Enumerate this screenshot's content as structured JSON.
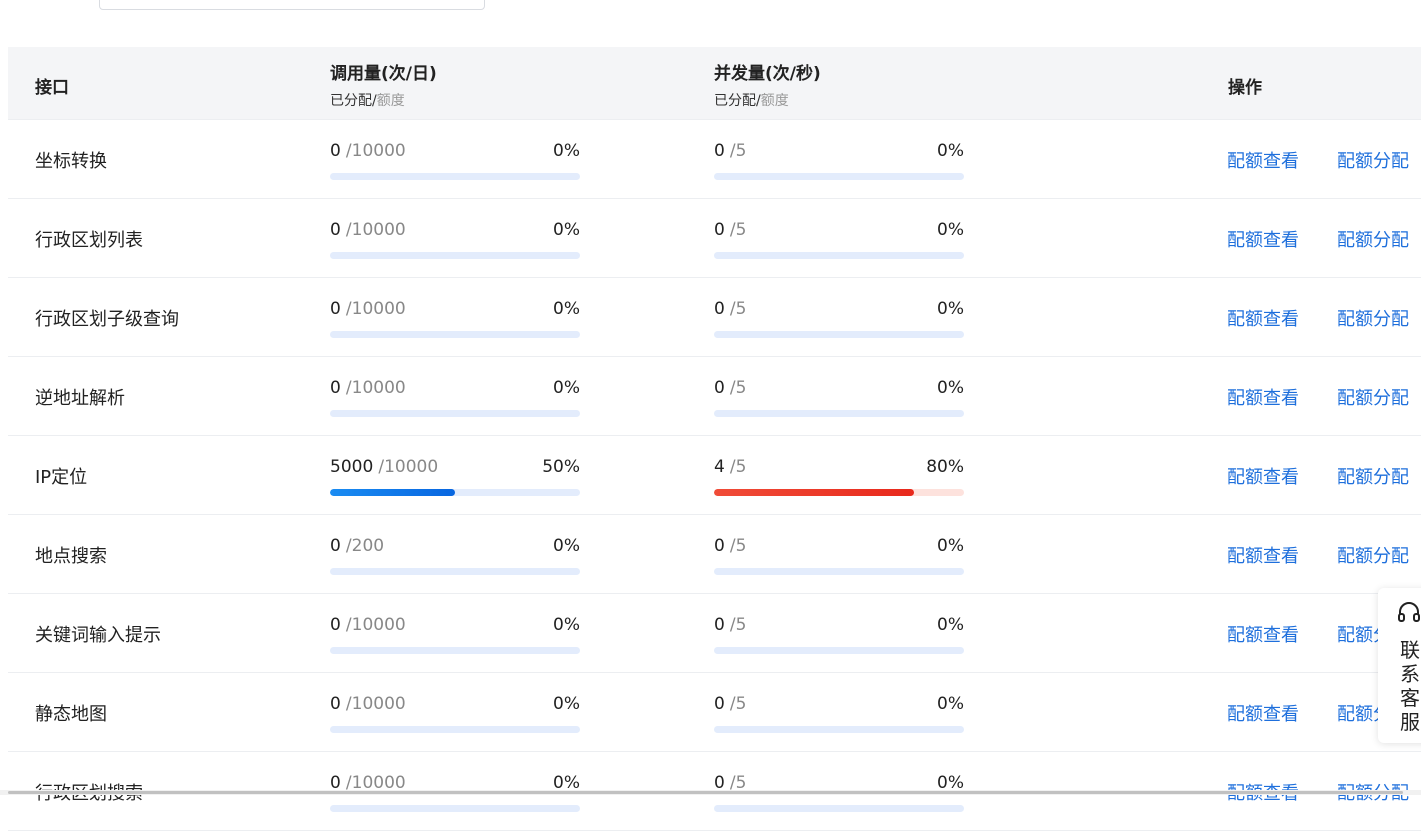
{
  "header": {
    "api": "接口",
    "calls_title": "调用量(次/日)",
    "concurrency_title": "并发量(次/秒)",
    "sub_allocated": "已分配/",
    "sub_quota": "额度",
    "ops": "操作"
  },
  "rows": [
    {
      "name": "坐标转换",
      "calls": {
        "used": "0",
        "quota": "/10000",
        "pct": "0%",
        "fraction": 0
      },
      "conc": {
        "used": "0",
        "quota": "/5",
        "pct": "0%",
        "fraction": 0
      },
      "view": "配额查看",
      "assign": "配额分配"
    },
    {
      "name": "行政区划列表",
      "calls": {
        "used": "0",
        "quota": "/10000",
        "pct": "0%",
        "fraction": 0
      },
      "conc": {
        "used": "0",
        "quota": "/5",
        "pct": "0%",
        "fraction": 0
      },
      "view": "配额查看",
      "assign": "配额分配"
    },
    {
      "name": "行政区划子级查询",
      "calls": {
        "used": "0",
        "quota": "/10000",
        "pct": "0%",
        "fraction": 0
      },
      "conc": {
        "used": "0",
        "quota": "/5",
        "pct": "0%",
        "fraction": 0
      },
      "view": "配额查看",
      "assign": "配额分配"
    },
    {
      "name": "逆地址解析",
      "calls": {
        "used": "0",
        "quota": "/10000",
        "pct": "0%",
        "fraction": 0
      },
      "conc": {
        "used": "0",
        "quota": "/5",
        "pct": "0%",
        "fraction": 0
      },
      "view": "配额查看",
      "assign": "配额分配"
    },
    {
      "name": "IP定位",
      "calls": {
        "used": "5000",
        "quota": "/10000",
        "pct": "50%",
        "fraction": 0.5
      },
      "conc": {
        "used": "4",
        "quota": "/5",
        "pct": "80%",
        "fraction": 0.8,
        "alert": true
      },
      "view": "配额查看",
      "assign": "配额分配"
    },
    {
      "name": "地点搜索",
      "calls": {
        "used": "0",
        "quota": "/200",
        "pct": "0%",
        "fraction": 0
      },
      "conc": {
        "used": "0",
        "quota": "/5",
        "pct": "0%",
        "fraction": 0
      },
      "view": "配额查看",
      "assign": "配额分配"
    },
    {
      "name": "关键词输入提示",
      "calls": {
        "used": "0",
        "quota": "/10000",
        "pct": "0%",
        "fraction": 0
      },
      "conc": {
        "used": "0",
        "quota": "/5",
        "pct": "0%",
        "fraction": 0
      },
      "view": "配额查看",
      "assign": "配额分配"
    },
    {
      "name": "静态地图",
      "calls": {
        "used": "0",
        "quota": "/10000",
        "pct": "0%",
        "fraction": 0
      },
      "conc": {
        "used": "0",
        "quota": "/5",
        "pct": "0%",
        "fraction": 0
      },
      "view": "配额查看",
      "assign": "配额分配"
    },
    {
      "name": "行政区划搜索",
      "calls": {
        "used": "0",
        "quota": "/10000",
        "pct": "0%",
        "fraction": 0
      },
      "conc": {
        "used": "0",
        "quota": "/5",
        "pct": "0%",
        "fraction": 0
      },
      "view": "配额查看",
      "assign": "配额分配"
    }
  ],
  "support": {
    "label": "联系客服",
    "icon": "headset-icon"
  },
  "colors": {
    "link": "#1e6fdc",
    "bar_track": "#e3ecfc",
    "bar_blue": "#0866e0",
    "bar_red": "#e8291c",
    "header_bg": "#f4f5f7"
  }
}
